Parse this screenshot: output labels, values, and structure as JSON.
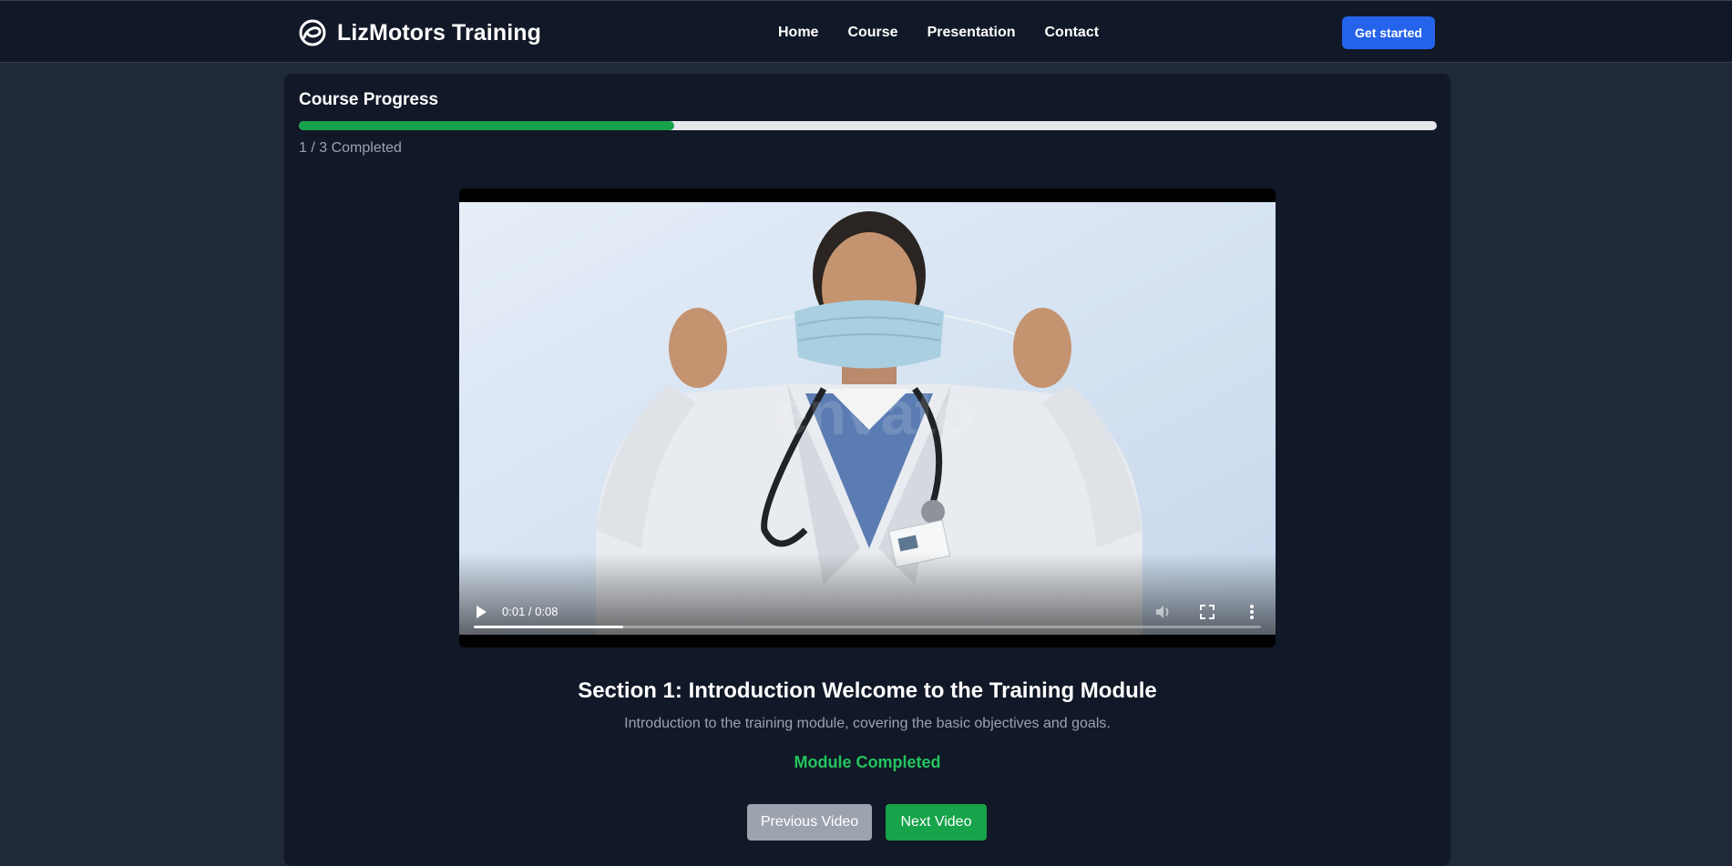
{
  "navbar": {
    "brand": "LizMotors Training",
    "logo_icon": "swirl-logo-icon",
    "links": [
      "Home",
      "Course",
      "Presentation",
      "Contact"
    ],
    "cta_label": "Get started",
    "cta_color": "#2563eb"
  },
  "progress": {
    "title": "Course Progress",
    "completed": 1,
    "total": 3,
    "fraction": 0.33,
    "text": "1 / 3 Completed",
    "bar_color": "#16a34a"
  },
  "video": {
    "time": "0:01 / 0:08",
    "played_fraction": 0.19,
    "controls": [
      "play-icon",
      "volume-icon",
      "fullscreen-icon",
      "more-vert-icon"
    ]
  },
  "section": {
    "title": "Section 1: Introduction Welcome to the Training Module",
    "description": "Introduction to the training module, covering the basic objectives and goals.",
    "status": "Module Completed",
    "status_color": "#22c55e"
  },
  "buttons": {
    "previous": "Previous Video",
    "next": "Next Video"
  }
}
